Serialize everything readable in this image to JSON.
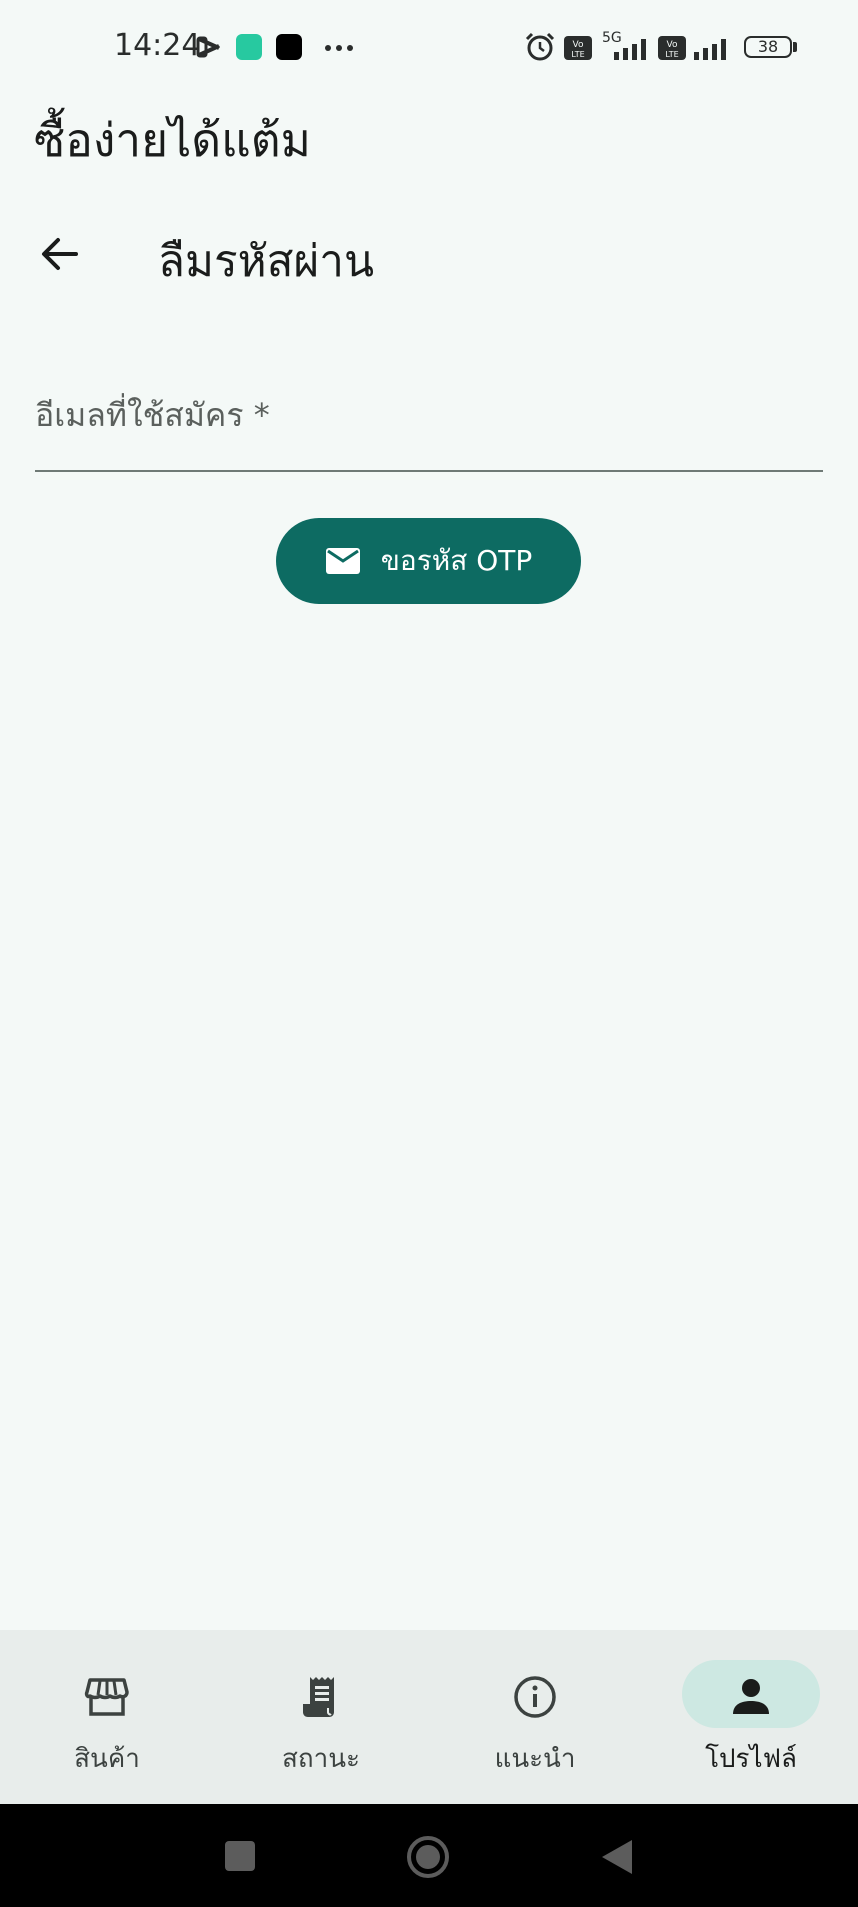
{
  "status_bar": {
    "time": "14:24",
    "battery": "38",
    "network": "5G",
    "icons": [
      "capcut-icon",
      "mi-icon",
      "app-icon",
      "more-dots-icon",
      "alarm-icon",
      "volte-icon",
      "signal-icon",
      "volte-icon",
      "signal-icon",
      "battery-icon"
    ]
  },
  "app": {
    "title": "ซื้อง่ายได้แต้ม"
  },
  "header": {
    "title": "ลืมรหัสผ่าน",
    "back_icon": "arrow-back-icon"
  },
  "form": {
    "email_label": "อีเมลที่ใช้สมัคร *",
    "email_value": ""
  },
  "otp_button": {
    "label": "ขอรหัส OTP",
    "icon": "mail-icon",
    "color": "#0d6b62"
  },
  "bottom_nav": {
    "items": [
      {
        "label": "สินค้า",
        "icon": "store-icon",
        "active": false
      },
      {
        "label": "สถานะ",
        "icon": "receipt-icon",
        "active": false
      },
      {
        "label": "แนะนำ",
        "icon": "info-icon",
        "active": false
      },
      {
        "label": "โปรไฟล์",
        "icon": "person-icon",
        "active": true
      }
    ],
    "active_color": "#cde8e2"
  },
  "system_nav": {
    "icons": [
      "recents-icon",
      "home-icon",
      "back-icon"
    ]
  }
}
